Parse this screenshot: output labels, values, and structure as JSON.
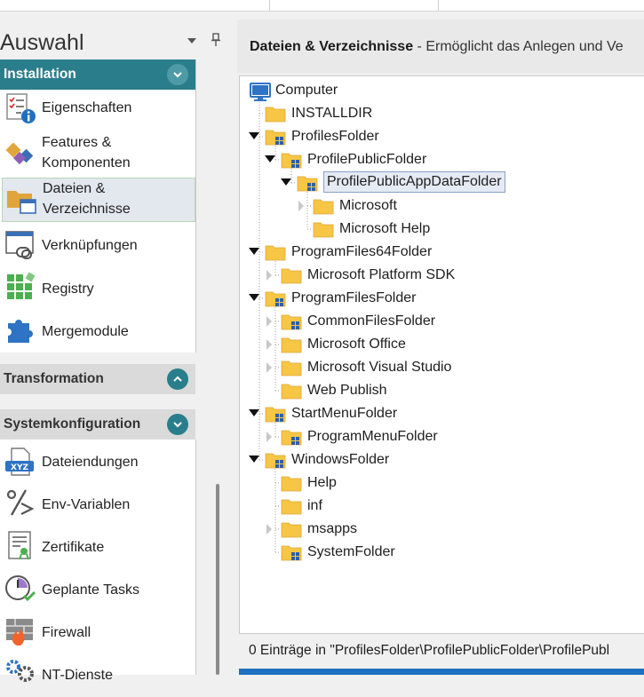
{
  "left_pane": {
    "title": "Auswahl",
    "dropdown_icon": "triangle-down-icon",
    "pin_icon": "pin-icon",
    "groups": [
      {
        "label": "Installation",
        "state": "expanded",
        "items": [
          {
            "label": "Eigenschaften",
            "icon": "properties-icon"
          },
          {
            "label": "Features &",
            "label2": "Komponenten",
            "icon": "features-icon"
          },
          {
            "label": "Dateien &",
            "label2": "Verzeichnisse",
            "icon": "files-icon",
            "selected": true
          },
          {
            "label": "Verknüpfungen",
            "icon": "shortcut-icon"
          },
          {
            "label": "Registry",
            "icon": "registry-icon"
          },
          {
            "label": "Mergemodule",
            "icon": "puzzle-icon"
          }
        ]
      },
      {
        "label": "Transformation",
        "state": "collapsed",
        "items": []
      },
      {
        "label": "Systemkonfiguration",
        "state": "expanded",
        "items": [
          {
            "label": "Dateiendungen",
            "icon": "file-extension-icon"
          },
          {
            "label": "Env-Variablen",
            "icon": "env-variable-icon"
          },
          {
            "label": "Zertifikate",
            "icon": "certificate-icon"
          },
          {
            "label": "Geplante Tasks",
            "icon": "scheduled-task-icon"
          },
          {
            "label": "Firewall",
            "icon": "firewall-icon"
          },
          {
            "label": "NT-Dienste",
            "icon": "gears-icon"
          }
        ]
      }
    ]
  },
  "right_pane": {
    "header_title": "Dateien & Verzeichnisse",
    "header_desc": " - Ermöglicht das Anlegen und Ve",
    "tree": [
      {
        "label": "Computer",
        "level": 0,
        "icon": "computer-icon"
      },
      {
        "label": "INSTALLDIR",
        "level": 1,
        "icon": "folder-icon"
      },
      {
        "label": "ProfilesFolder",
        "level": 1,
        "icon": "system-folder-icon",
        "expanded": true
      },
      {
        "label": "ProfilePublicFolder",
        "level": 2,
        "icon": "system-folder-icon",
        "expanded": true
      },
      {
        "label": "ProfilePublicAppDataFolder",
        "level": 3,
        "icon": "system-folder-icon",
        "expanded": true,
        "selected": true
      },
      {
        "label": "Microsoft",
        "level": 4,
        "icon": "folder-icon",
        "collapsed": true
      },
      {
        "label": "Microsoft Help",
        "level": 4,
        "icon": "folder-icon"
      },
      {
        "label": "ProgramFiles64Folder",
        "level": 1,
        "icon": "folder-icon",
        "expanded": true
      },
      {
        "label": "Microsoft Platform SDK",
        "level": 2,
        "icon": "folder-icon",
        "collapsed": true
      },
      {
        "label": "ProgramFilesFolder",
        "level": 1,
        "icon": "system-folder-icon",
        "expanded": true
      },
      {
        "label": "CommonFilesFolder",
        "level": 2,
        "icon": "system-folder-icon",
        "collapsed": true
      },
      {
        "label": "Microsoft Office",
        "level": 2,
        "icon": "folder-icon",
        "collapsed": true
      },
      {
        "label": "Microsoft Visual Studio",
        "level": 2,
        "icon": "folder-icon",
        "collapsed": true
      },
      {
        "label": "Web Publish",
        "level": 2,
        "icon": "folder-icon"
      },
      {
        "label": "StartMenuFolder",
        "level": 1,
        "icon": "system-folder-icon",
        "expanded": true
      },
      {
        "label": "ProgramMenuFolder",
        "level": 2,
        "icon": "system-folder-icon",
        "collapsed": true
      },
      {
        "label": "WindowsFolder",
        "level": 1,
        "icon": "system-folder-icon",
        "expanded": true
      },
      {
        "label": "Help",
        "level": 2,
        "icon": "folder-icon"
      },
      {
        "label": "inf",
        "level": 2,
        "icon": "folder-icon"
      },
      {
        "label": "msapps",
        "level": 2,
        "icon": "folder-icon",
        "collapsed": true
      },
      {
        "label": "SystemFolder",
        "level": 2,
        "icon": "system-folder-icon"
      }
    ],
    "status": "0 Einträge in \"ProfilesFolder\\ProfilePublicFolder\\ProfilePubl"
  },
  "colors": {
    "accent_teal": "#2a7e8b",
    "folder_yellow": "#f6c644",
    "selection_border": "#8aa0c6",
    "bottom_bar": "#1f6fc0"
  }
}
